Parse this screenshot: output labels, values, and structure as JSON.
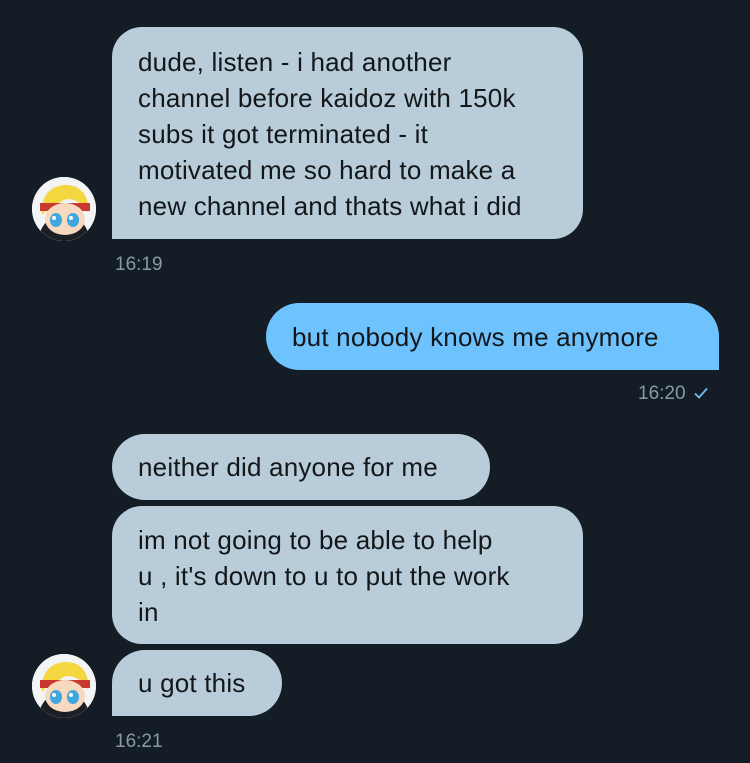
{
  "conversation": {
    "messages": [
      {
        "text": "dude, listen - i had another\nchannel before kaidoz with 150k\nsubs it got terminated - it\nmotivated me so hard to make a\nnew channel and thats what i did"
      },
      {
        "text": "16:19"
      },
      {
        "text": "but nobody knows me anymore"
      },
      {
        "text": "16:20"
      },
      {
        "text": "neither did anyone for me"
      },
      {
        "text": "im not going to be able to help\nu , it's down to u to put the work\nin"
      },
      {
        "text": "u got this"
      },
      {
        "text": "16:21"
      }
    ]
  },
  "colors": {
    "background": "#141d26",
    "incoming_bubble": "#b8ccd9",
    "outgoing_bubble": "#6ec3ff",
    "timestamp": "#8899a6",
    "read_check": "#6ec3ff"
  },
  "icons": {
    "avatar": "cartoon-avatar-icon",
    "read_receipt": "check-icon"
  }
}
